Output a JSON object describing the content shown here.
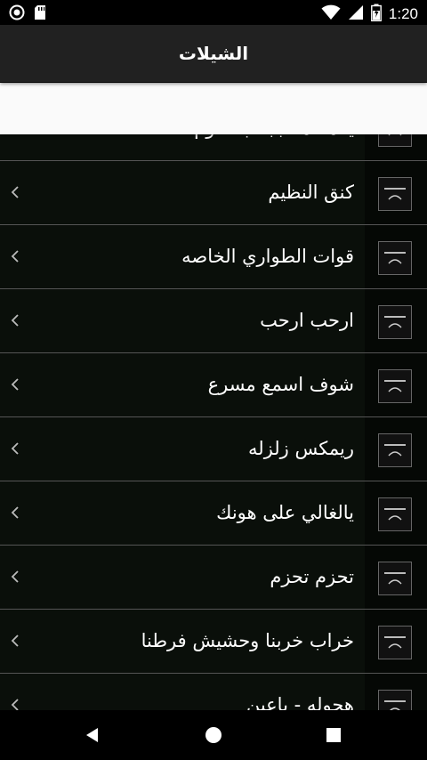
{
  "status_bar": {
    "time": "1:20",
    "battery_level": 0.6
  },
  "app_bar": {
    "title": "الشيلات"
  },
  "list": {
    "items": [
      {
        "label": "يا هلا هلا بجدب علوم"
      },
      {
        "label": "كنق النظيم"
      },
      {
        "label": "قوات الطواري الخاصه"
      },
      {
        "label": "ارحب ارحب"
      },
      {
        "label": "شوف اسمع مسرع"
      },
      {
        "label": "ريمكس زلزله"
      },
      {
        "label": "يالغالي على هونك"
      },
      {
        "label": "تحزم تحزم"
      },
      {
        "label": "خراب خربنا وحشيش فرطنا"
      },
      {
        "label": "هجوله - باعين"
      }
    ]
  },
  "icons": {
    "status_left": [
      "record-icon",
      "sd-card-icon"
    ],
    "status_right": [
      "wifi-icon",
      "signal-icon",
      "battery-icon"
    ],
    "row_chevron": "chevron-left-icon",
    "row_thumb": "thumbnail-icon",
    "nav": [
      "back-icon",
      "home-icon",
      "recents-icon"
    ]
  },
  "colors": {
    "app_bar": "#212121",
    "row_bg": "#0a0f0a",
    "divider": "#555555",
    "text": "#ffffff"
  }
}
